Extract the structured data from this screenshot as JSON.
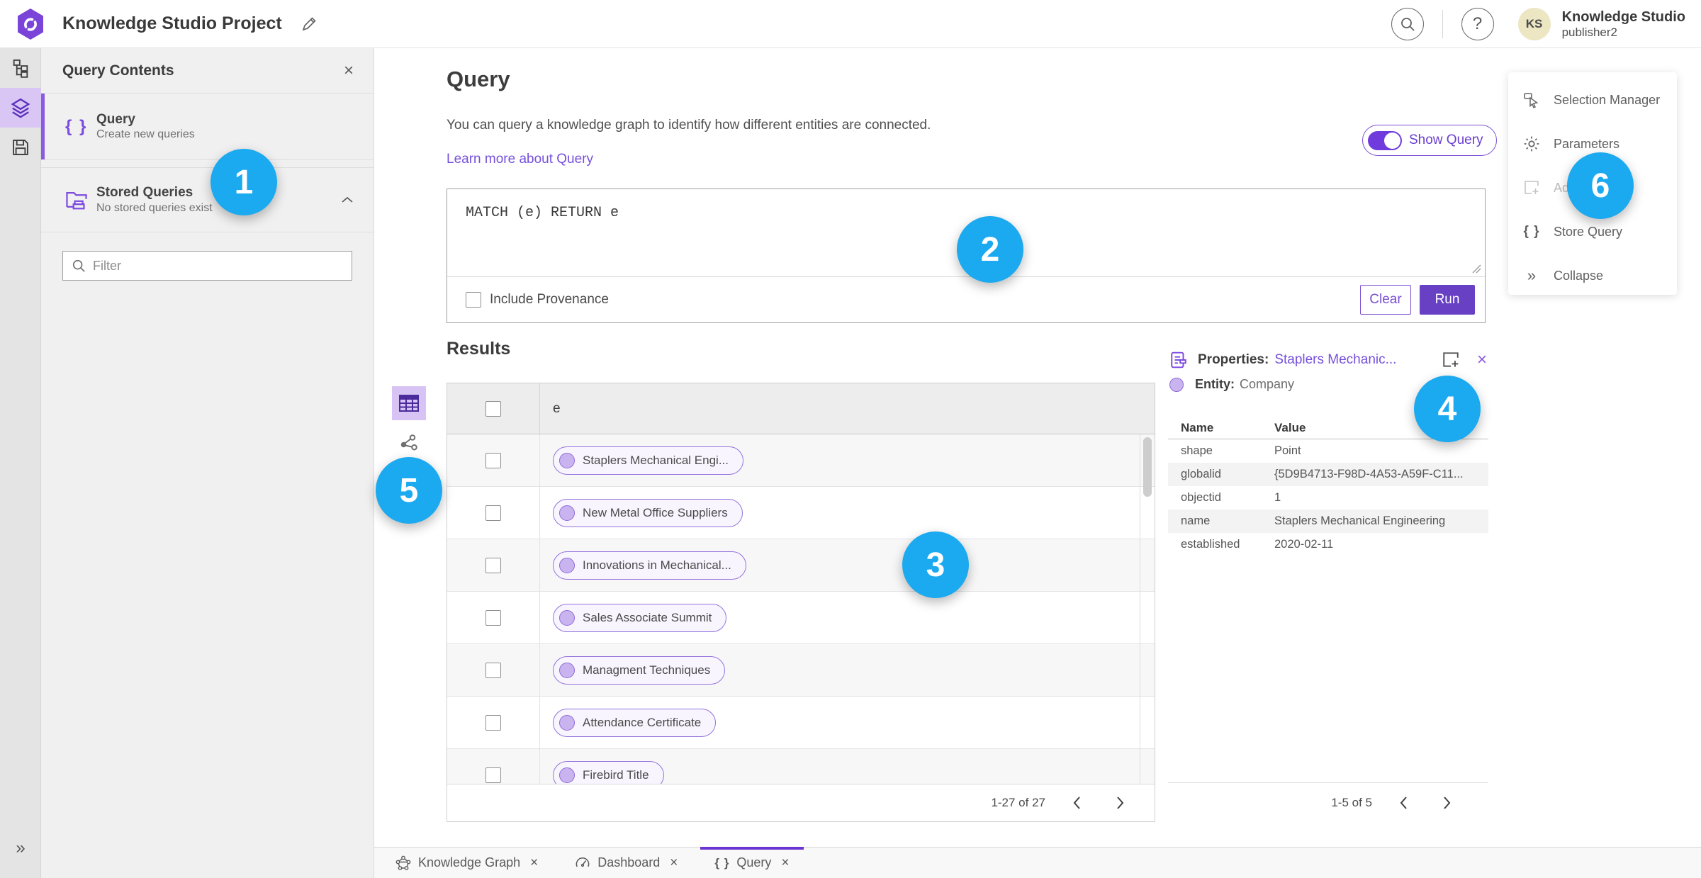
{
  "colors": {
    "brand_purple": "#6740c4",
    "link_purple": "#7650db",
    "accent_lavender": "#d9c6f5",
    "badge_blue": "#1ba9f0"
  },
  "icons": {
    "search": "magnifier",
    "help": "?",
    "edit": "pencil",
    "close": "×",
    "collapse": "»",
    "chevron-left": "‹",
    "chevron-right": "›",
    "chevron-up": "^"
  },
  "topbar": {
    "title": "Knowledge Studio Project",
    "user_name": "Knowledge Studio",
    "user_role": "publisher2",
    "avatar_initials": "KS"
  },
  "query_contents": {
    "title": "Query Contents",
    "query_item": {
      "label": "Query",
      "sublabel": "Create new queries"
    },
    "stored_queries": {
      "label": "Stored Queries",
      "sublabel": "No stored queries exist"
    },
    "filter_placeholder": "Filter"
  },
  "query_panel": {
    "title": "Query",
    "description": "You can query a knowledge graph to identify how different entities are connected.",
    "learn_more": "Learn more about Query",
    "show_query_label": "Show Query",
    "query_text": "MATCH (e) RETURN e",
    "include_provenance_label": "Include Provenance",
    "clear_label": "Clear",
    "run_label": "Run"
  },
  "results": {
    "title": "Results",
    "column_header": "e",
    "rows": [
      "Staplers Mechanical Engi...",
      "New Metal Office Suppliers",
      "Innovations in Mechanical...",
      "Sales Associate Summit",
      "Managment Techniques",
      "Attendance Certificate",
      "Firebird Title"
    ],
    "pagination": "1-27 of 27"
  },
  "properties": {
    "title_prefix": "Properties:",
    "title_link": "Staplers Mechanic...",
    "entity_prefix": "Entity:",
    "entity_value": "Company",
    "columns": {
      "name": "Name",
      "value": "Value"
    },
    "rows": [
      {
        "name": "shape",
        "value": "Point"
      },
      {
        "name": "globalid",
        "value": "{5D9B4713-F98D-4A53-A59F-C11..."
      },
      {
        "name": "objectid",
        "value": "1"
      },
      {
        "name": "name",
        "value": "Staplers Mechanical Engineering"
      },
      {
        "name": "established",
        "value": "2020-02-11"
      }
    ],
    "pagination": "1-5 of 5"
  },
  "side_menu": {
    "items": [
      {
        "icon": "selection-manager-icon",
        "label": "Selection Manager",
        "disabled": false
      },
      {
        "icon": "gear-icon",
        "label": "Parameters",
        "disabled": false
      },
      {
        "icon": "add-new-icon",
        "label": "Ad",
        "disabled": true
      },
      {
        "icon": "braces-icon",
        "label": "Store Query",
        "disabled": false
      },
      {
        "icon": "collapse-icon",
        "label": "Collapse",
        "disabled": false
      }
    ]
  },
  "tabs": [
    {
      "icon": "knowledge-graph-icon",
      "label": "Knowledge Graph",
      "active": false
    },
    {
      "icon": "dashboard-icon",
      "label": "Dashboard",
      "active": false
    },
    {
      "icon": "braces-icon",
      "label": "Query",
      "active": true
    }
  ],
  "annotations": [
    "1",
    "2",
    "3",
    "4",
    "5",
    "6"
  ]
}
